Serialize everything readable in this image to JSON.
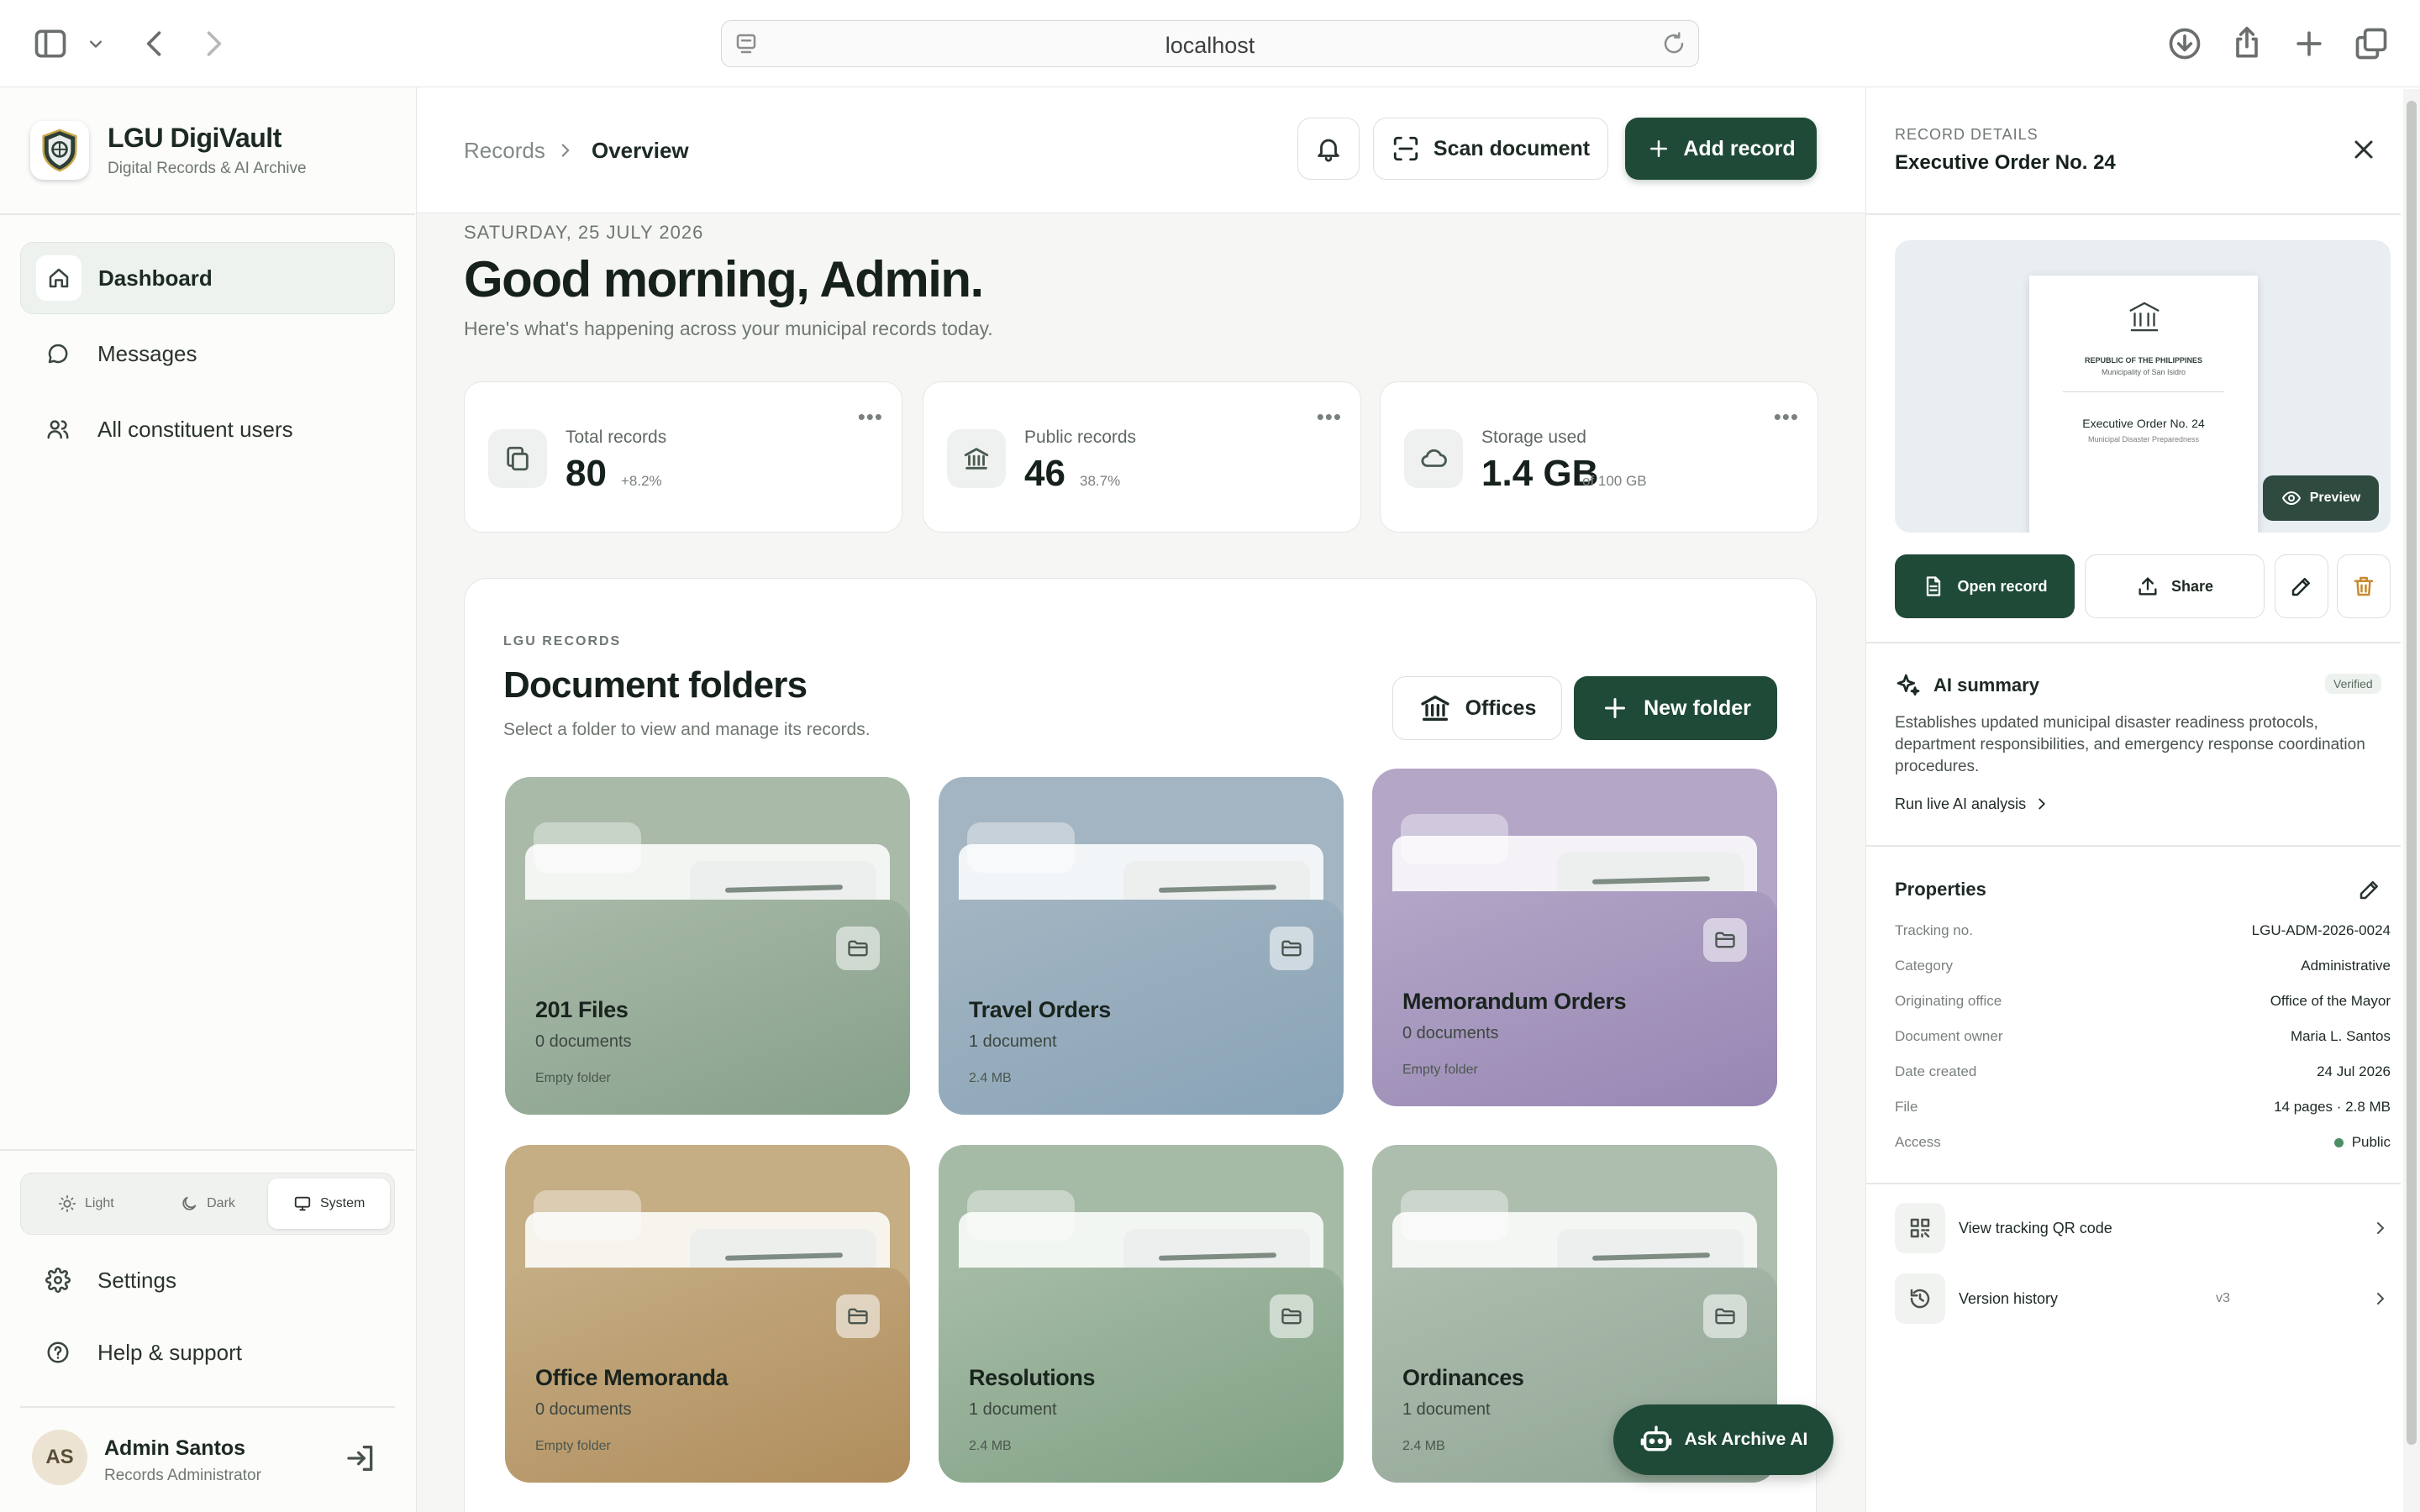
{
  "browser": {
    "url": "localhost",
    "icons": [
      "sidebar-toggle-icon",
      "chevron-down-icon",
      "back-arrow-icon",
      "forward-arrow-icon",
      "page-icon",
      "reload-icon",
      "download-icon",
      "share-icon",
      "plus-icon",
      "tabs-icon"
    ]
  },
  "brand": {
    "name": "LGU DigiVault",
    "subtitle": "Digital Records & AI Archive"
  },
  "sidebar": {
    "nav": [
      {
        "label": "Dashboard",
        "icon": "home-icon",
        "active": true
      },
      {
        "label": "Messages",
        "icon": "message-icon",
        "active": false
      },
      {
        "label": "All constituent users",
        "icon": "users-icon",
        "active": false
      }
    ],
    "theme": [
      {
        "label": "Light",
        "icon": "sun-icon"
      },
      {
        "label": "Dark",
        "icon": "moon-icon"
      },
      {
        "label": "System",
        "icon": "monitor-icon",
        "selected": true
      }
    ],
    "footer": [
      {
        "label": "Settings",
        "icon": "gear-icon"
      },
      {
        "label": "Help & support",
        "icon": "help-icon"
      }
    ],
    "user": {
      "initials": "AS",
      "name": "Admin Santos",
      "role": "Records Administrator"
    }
  },
  "topbar": {
    "crumb_parent": "Records",
    "crumb_current": "Overview",
    "scan_label": "Scan document",
    "add_label": "Add record"
  },
  "hero": {
    "date": "SATURDAY, 25 JULY 2026",
    "greeting": "Good morning, Admin.",
    "subtitle": "Here's what's happening across your municipal records today."
  },
  "stats": [
    {
      "label": "Total records",
      "value": "80",
      "detail": "+8.2%",
      "icon": "copy-icon"
    },
    {
      "label": "Public records",
      "value": "46",
      "detail": "38.7%",
      "icon": "building-icon"
    },
    {
      "label": "Storage used",
      "value": "1.4 GB",
      "detail": "of 100 GB",
      "icon": "cloud-icon"
    }
  ],
  "folders": {
    "kicker": "LGU RECORDS",
    "title": "Document folders",
    "subtitle": "Select a folder to view and manage its records.",
    "offices_label": "Offices",
    "new_folder_label": "New folder",
    "items": [
      {
        "name": "201 Files",
        "count": "0 documents",
        "size": "Empty folder",
        "color_back": "#a9baa9",
        "color_front": "#86a08a"
      },
      {
        "name": "Travel Orders",
        "count": "1 document",
        "size": "2.4 MB",
        "color_back": "#a3b5c2",
        "color_front": "#88a3b7"
      },
      {
        "name": "Memorandum Orders",
        "count": "0 documents",
        "size": "Empty folder",
        "color_back": "#b3a6c7",
        "color_front": "#9786b3"
      },
      {
        "name": "Office Memoranda",
        "count": "0 documents",
        "size": "Empty folder",
        "color_back": "#c5ad84",
        "color_front": "#b08d5c"
      },
      {
        "name": "Resolutions",
        "count": "1 document",
        "size": "2.4 MB",
        "color_back": "#a6bba6",
        "color_front": "#7fa183"
      },
      {
        "name": "Ordinances",
        "count": "1 document",
        "size": "2.4 MB",
        "color_back": "#adbdae",
        "color_front": "#91a696"
      }
    ]
  },
  "ask_ai_label": "Ask Archive AI",
  "details": {
    "kicker": "RECORD DETAILS",
    "title": "Executive Order No. 24",
    "doc": {
      "republic": "REPUBLIC OF THE PHILIPPINES",
      "municipality": "Municipality of San Isidro",
      "title": "Executive Order No. 24",
      "subject": "Municipal Disaster Preparedness"
    },
    "preview_label": "Preview",
    "actions": {
      "open": "Open record",
      "share": "Share"
    },
    "ai": {
      "title": "AI summary",
      "badge": "Verified",
      "body": "Establishes updated municipal disaster readiness protocols, department responsibilities, and emergency response coordination procedures.",
      "run": "Run live AI analysis"
    },
    "properties_title": "Properties",
    "properties": [
      {
        "key": "Tracking no.",
        "value": "LGU-ADM-2026-0024"
      },
      {
        "key": "Category",
        "value": "Administrative"
      },
      {
        "key": "Originating office",
        "value": "Office of the Mayor"
      },
      {
        "key": "Document owner",
        "value": "Maria L. Santos"
      },
      {
        "key": "Date created",
        "value": "24 Jul 2026"
      },
      {
        "key": "File",
        "value": "14 pages · 2.8 MB"
      },
      {
        "key": "Access",
        "value": "Public"
      }
    ],
    "links": [
      {
        "label": "View tracking QR code",
        "value": "",
        "icon": "qr-icon"
      },
      {
        "label": "Version history",
        "value": "v3",
        "icon": "history-icon"
      }
    ]
  },
  "colors": {
    "accent": "#1f4a38",
    "status_public": "#4b8e63",
    "delete": "#c78a2e"
  }
}
